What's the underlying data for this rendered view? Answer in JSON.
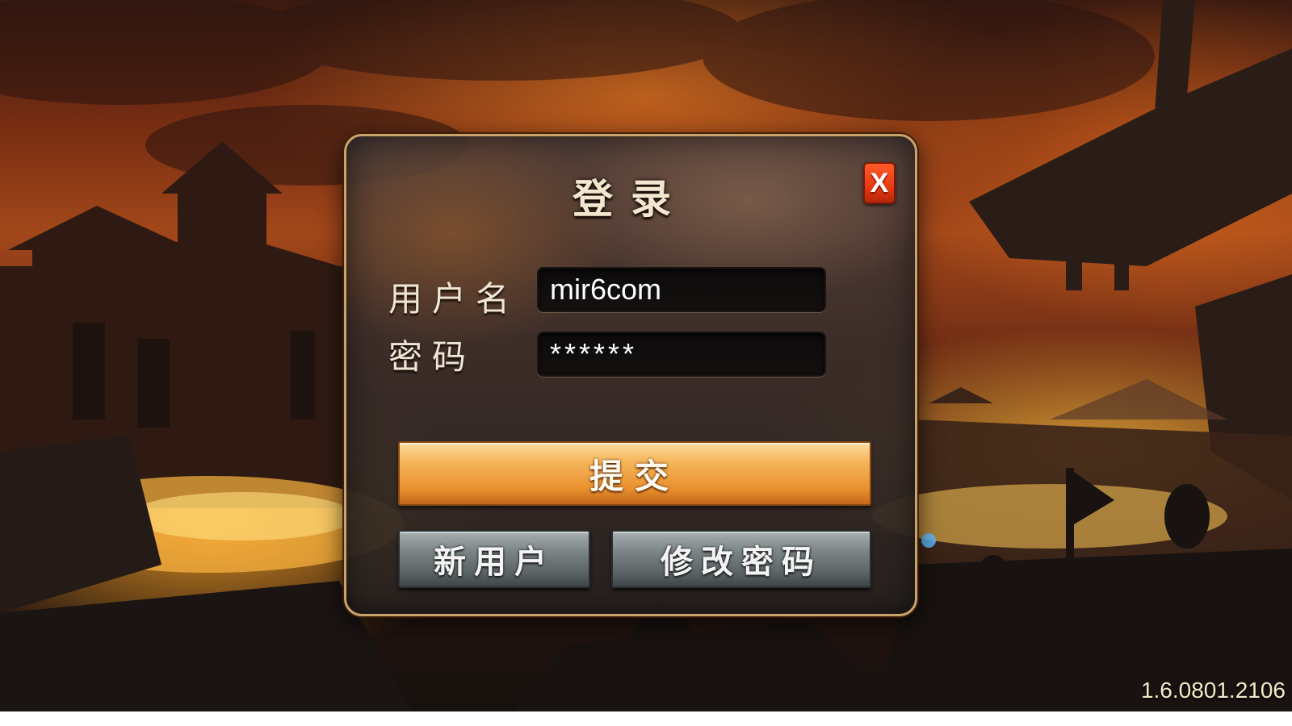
{
  "dialog": {
    "title": "登录",
    "close_label": "X",
    "username_label": "用户名",
    "username_value": "mir6com",
    "password_label": "密码",
    "password_value": "******",
    "submit_label": "提交",
    "new_user_label": "新用户",
    "change_password_label": "修改密码"
  },
  "version": "1.6.0801.2106",
  "colors": {
    "dialog_border": "#c9a46a",
    "close_button": "#e83a12",
    "submit_button": "#e9902e",
    "secondary_button": "#7c8587",
    "version_text": "#f2ebc8"
  },
  "icons": {
    "close": "close-icon"
  }
}
